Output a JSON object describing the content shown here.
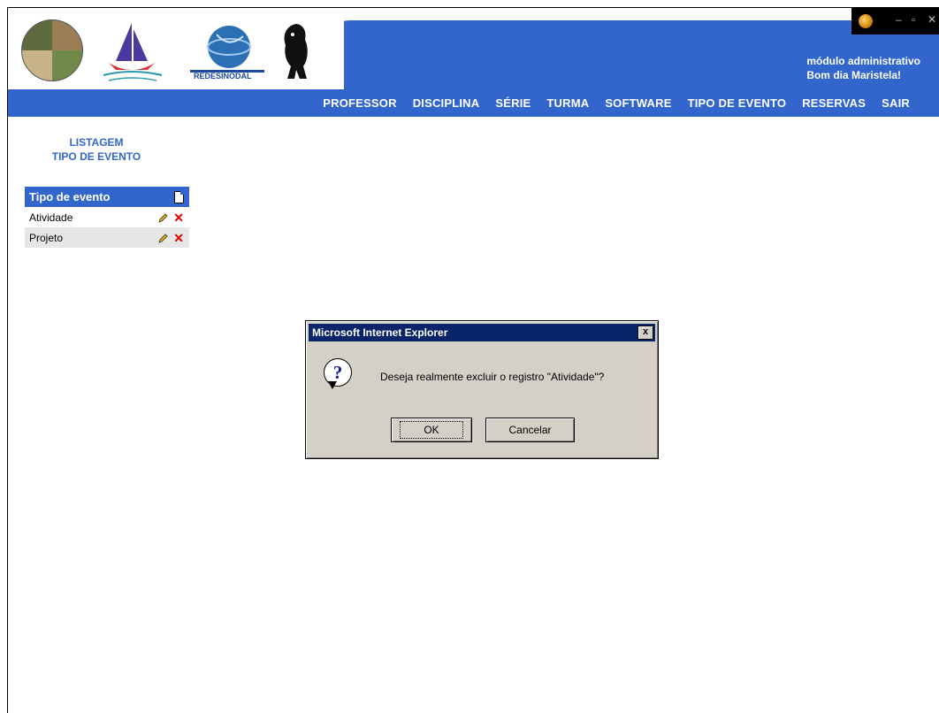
{
  "header": {
    "module_label": "módulo administrativo",
    "greeting": "Bom dia Maristela!",
    "logo_text": "REDESINODAL"
  },
  "nav": {
    "items": [
      "PROFESSOR",
      "DISCIPLINA",
      "SÉRIE",
      "TURMA",
      "SOFTWARE",
      "TIPO DE EVENTO",
      "RESERVAS",
      "SAIR"
    ]
  },
  "sidebar": {
    "title_line1": "LISTAGEM",
    "title_line2": "TIPO DE EVENTO"
  },
  "table": {
    "header": "Tipo de evento",
    "rows": [
      "Atividade",
      "Projeto"
    ]
  },
  "dialog": {
    "title": "Microsoft Internet Explorer",
    "message": "Deseja realmente excluir o registro \"Atividade\"?",
    "ok_label": "OK",
    "cancel_label": "Cancelar",
    "close_label": "x"
  },
  "colors": {
    "brand_blue": "#3366cc",
    "dialog_title_bg": "#0a246a",
    "dialog_bg": "#d4d0c8",
    "delete_red": "#e00000"
  },
  "icons": [
    "ie-icon",
    "new-record-icon",
    "edit-pencil-icon",
    "delete-x-icon",
    "question-icon",
    "close-icon"
  ]
}
